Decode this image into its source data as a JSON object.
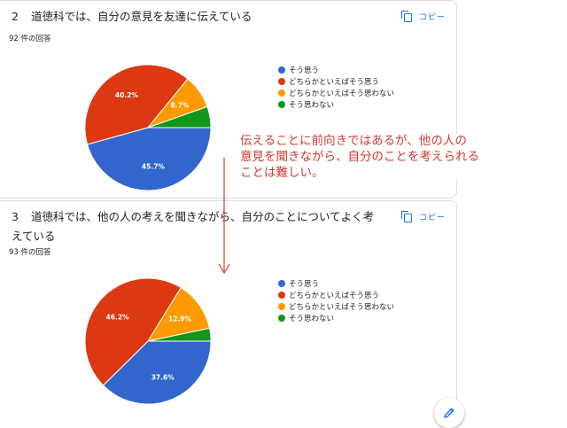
{
  "copy_label": "コピー",
  "colors": {
    "series": [
      "#3366cc",
      "#dc3912",
      "#ff9900",
      "#109618"
    ],
    "annotation": "#d33a31",
    "accent": "#1a73e8"
  },
  "annotation": {
    "line1": "伝えることに前向きではあるが、他の人の",
    "line2": "意見を聞きながら、自分のことを考えられる",
    "line3": "ことは難しい。"
  },
  "edit_icon": "pencil-icon",
  "chart_data": [
    {
      "type": "pie",
      "number": "2",
      "title": "道徳科では、自分の意見を友達に伝えている",
      "responses": "92 件の回答",
      "categories": [
        "そう思う",
        "どちらかといえばそう思う",
        "どちらかといえばそう思わない",
        "そう思わない"
      ],
      "values": [
        45.7,
        40.2,
        8.7,
        5.4
      ],
      "labels": [
        "45.7%",
        "40.2%",
        "8.7%",
        ""
      ],
      "legend": "right"
    },
    {
      "type": "pie",
      "number": "3",
      "title": "道徳科では、他の人の考えを聞きながら、自分のことについてよく考えている",
      "responses": "93 件の回答",
      "categories": [
        "そう思う",
        "どちらかといえばそう思う",
        "どちらかといえばそう思わない",
        "そう思わない"
      ],
      "values": [
        37.6,
        46.2,
        12.9,
        3.3
      ],
      "labels": [
        "37.6%",
        "46.2%",
        "12.9%",
        ""
      ],
      "legend": "right"
    }
  ]
}
